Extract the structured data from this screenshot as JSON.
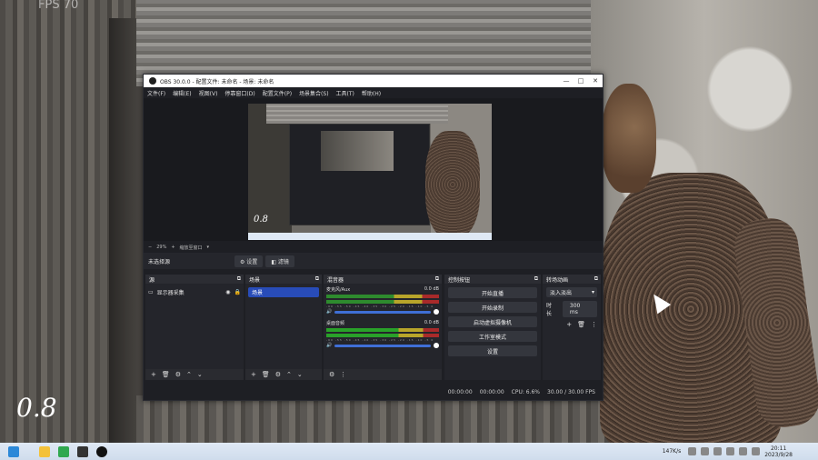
{
  "background": {
    "fps_label": "FPS 70",
    "scale_label": "0.8"
  },
  "obs": {
    "title": "OBS 30.0.0 - 配置文件: 未命名 - 场景: 未命名",
    "window_buttons": [
      "—",
      "□",
      "✕"
    ],
    "menu": [
      "文件(F)",
      "编辑(E)",
      "视图(V)",
      "停靠窗口(D)",
      "配置文件(P)",
      "场景集合(S)",
      "工具(T)",
      "帮助(H)"
    ],
    "preview_scale_label": "0.8",
    "zoom_label": "29%",
    "zoom_mode": "缩放至窗口",
    "no_scene_selected": "未选择源",
    "properties_button": "设置",
    "filters_button": "滤镜",
    "panels": {
      "sources": {
        "title": "源",
        "items": [
          "显示器采集"
        ]
      },
      "scenes": {
        "title": "场景",
        "items": [
          "场景"
        ]
      },
      "mixer": {
        "title": "混音器",
        "channels": [
          {
            "name": "麦克风/Aux",
            "db": "0.0 dB"
          },
          {
            "name": "桌面音频",
            "db": "0.0 dB"
          }
        ],
        "tick_marks": "-60 -55 -50 -45 -40 -35 -30 -25 -20 -15 -10 -5 0"
      },
      "controls": {
        "title": "控制按钮",
        "buttons": [
          "开始直播",
          "开始录制",
          "启动虚拟摄像机",
          "工作室模式",
          "设置"
        ]
      },
      "transitions": {
        "title": "转场动画",
        "selected": "淡入淡出",
        "duration_label": "时长",
        "duration_value": "300 ms"
      }
    },
    "status": {
      "stream_time": "00:00:00",
      "record_time": "00:00:00",
      "cpu": "CPU: 6.6%",
      "fps": "30.00 / 30.00 FPS"
    }
  },
  "taskbar": {
    "clock_time": "20:11",
    "clock_date": "2023/9/28",
    "network_speed": "147K/s"
  }
}
